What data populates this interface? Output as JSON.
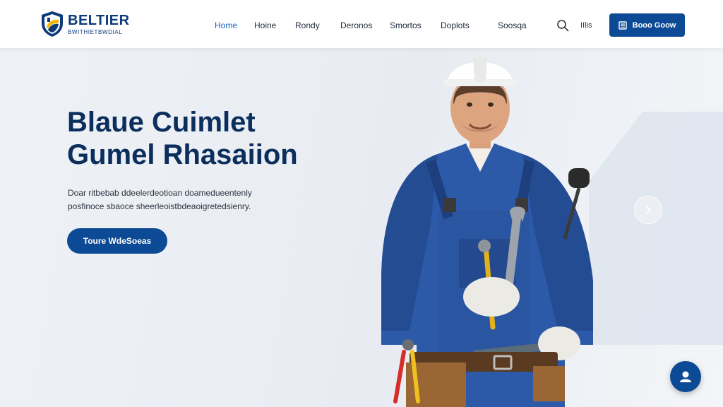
{
  "brand": {
    "name": "BELTIER",
    "tagline": "BWITHIETBWDIAL"
  },
  "nav": {
    "items": [
      {
        "label": "Home",
        "active": true
      },
      {
        "label": "Hoine",
        "active": false
      },
      {
        "label": "Rondy",
        "active": false
      },
      {
        "label": "Deronos",
        "active": false
      },
      {
        "label": "Smortos",
        "active": false
      },
      {
        "label": "Doplots",
        "active": false
      },
      {
        "label": "Soosqa",
        "active": false
      }
    ],
    "lang_label": "IIlis",
    "cta_label": "Booo Goow"
  },
  "hero": {
    "title_line1": "Blaue Cuimlet",
    "title_line2": "Gumel Rhasaiion",
    "desc_line1": "Doar ritbebab ddeelerdeotioan doamedueentenly",
    "desc_line2": "posfinoce sbaoce sheerleoistbdeaoigretedsienry.",
    "cta_label": "Toure WdeSoeas"
  },
  "icons": {
    "logo": "shield-logo-icon",
    "search": "search-icon",
    "cta_doc": "document-icon",
    "next": "chevron-right-icon",
    "chat": "user-chat-icon"
  },
  "colors": {
    "brand_blue": "#0d4a96",
    "title_navy": "#0b2e5c",
    "nav_active": "#1565c0"
  }
}
